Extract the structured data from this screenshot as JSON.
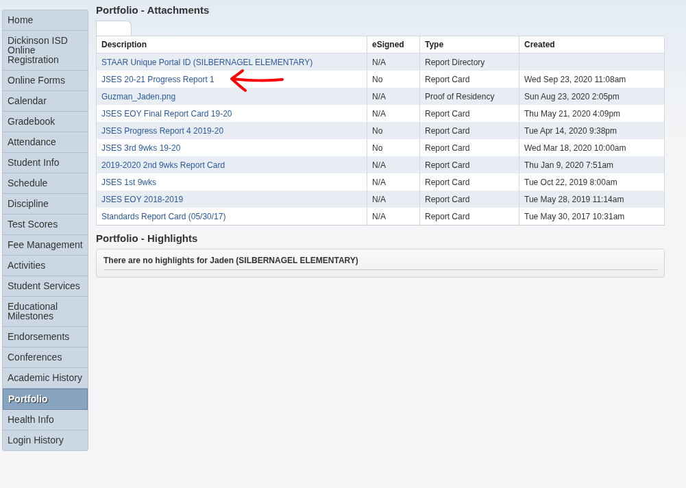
{
  "sidebar": {
    "items": [
      {
        "label": "Home",
        "selected": false
      },
      {
        "label": "Dickinson ISD Online Registration",
        "selected": false
      },
      {
        "label": "Online Forms",
        "selected": false
      },
      {
        "label": "Calendar",
        "selected": false
      },
      {
        "label": "Gradebook",
        "selected": false
      },
      {
        "label": "Attendance",
        "selected": false
      },
      {
        "label": "Student Info",
        "selected": false
      },
      {
        "label": "Schedule",
        "selected": false
      },
      {
        "label": "Discipline",
        "selected": false
      },
      {
        "label": "Test Scores",
        "selected": false
      },
      {
        "label": "Fee Management",
        "selected": false
      },
      {
        "label": "Activities",
        "selected": false
      },
      {
        "label": "Student Services",
        "selected": false
      },
      {
        "label": "Educational Milestones",
        "selected": false
      },
      {
        "label": "Endorsements",
        "selected": false
      },
      {
        "label": "Conferences",
        "selected": false
      },
      {
        "label": "Academic History",
        "selected": false
      },
      {
        "label": "Portfolio",
        "selected": true
      },
      {
        "label": "Health Info",
        "selected": false
      },
      {
        "label": "Login History",
        "selected": false
      }
    ]
  },
  "attachments": {
    "title": "Portfolio - Attachments",
    "table": {
      "columns": [
        "Description",
        "eSigned",
        "Type",
        "Created"
      ],
      "rows": [
        [
          "STAAR Unique Portal ID (SILBERNAGEL ELEMENTARY)",
          "N/A",
          "Report Directory",
          ""
        ],
        [
          "JSES 20-21 Progress Report 1",
          "No",
          "Report Card",
          "Wed Sep 23, 2020 11:08am"
        ],
        [
          "Guzman_Jaden.png",
          "N/A",
          "Proof of Residency",
          "Sun Aug 23, 2020 2:05pm"
        ],
        [
          "JSES EOY Final Report Card 19-20",
          "N/A",
          "Report Card",
          "Thu May 21, 2020 4:09pm"
        ],
        [
          "JSES Progress Report 4 2019-20",
          "No",
          "Report Card",
          "Tue Apr 14, 2020 9:38pm"
        ],
        [
          "JSES 3rd 9wks 19-20",
          "No",
          "Report Card",
          "Wed Mar 18, 2020 10:00am"
        ],
        [
          "2019-2020 2nd 9wks Report Card",
          "N/A",
          "Report Card",
          "Thu Jan 9, 2020 7:51am"
        ],
        [
          "JSES 1st 9wks",
          "N/A",
          "Report Card",
          "Tue Oct 22, 2019 8:00am"
        ],
        [
          "JSES EOY 2018-2019",
          "N/A",
          "Report Card",
          "Tue May 28, 2019 11:14am"
        ],
        [
          "Standards Report Card (05/30/17)",
          "N/A",
          "Report Card",
          "Tue May 30, 2017 10:31am"
        ]
      ]
    }
  },
  "highlights": {
    "title": "Portfolio - Highlights",
    "message": "There are no highlights for Jaden (SILBERNAGEL ELEMENTARY)"
  }
}
